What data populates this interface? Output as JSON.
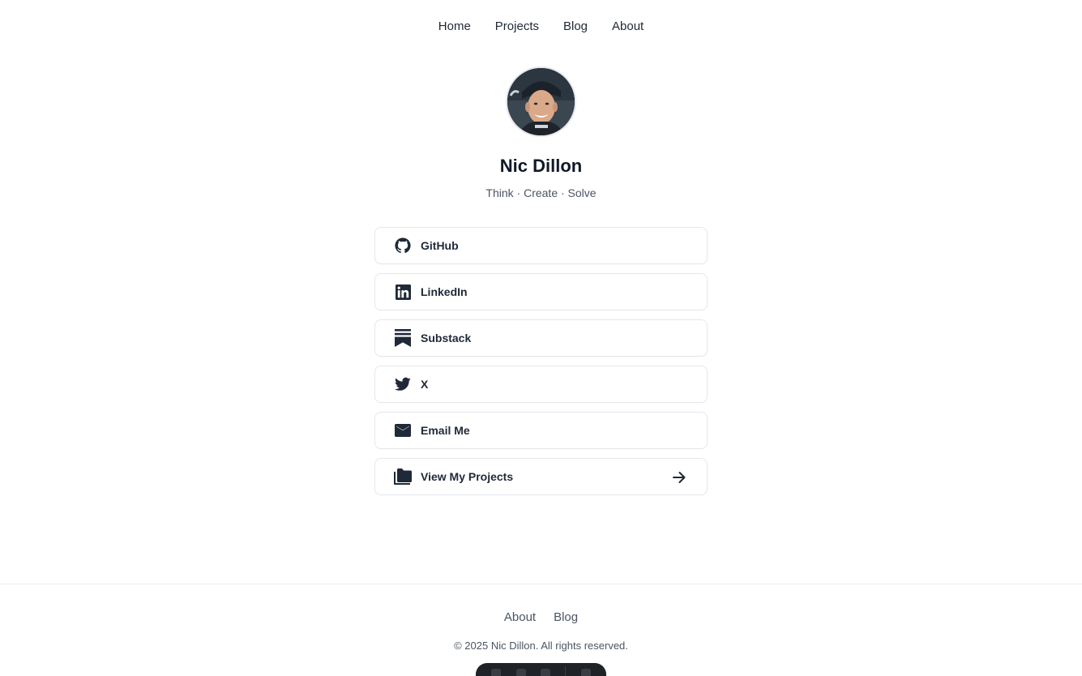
{
  "nav": {
    "items": [
      {
        "label": "Home"
      },
      {
        "label": "Projects"
      },
      {
        "label": "Blog"
      },
      {
        "label": "About"
      }
    ]
  },
  "profile": {
    "name": "Nic Dillon",
    "tagline": "Think · Create · Solve"
  },
  "links": [
    {
      "label": "GitHub",
      "icon": "github-icon"
    },
    {
      "label": "LinkedIn",
      "icon": "linkedin-icon"
    },
    {
      "label": "Substack",
      "icon": "substack-icon"
    },
    {
      "label": "X",
      "icon": "twitter-bird-icon"
    },
    {
      "label": "Email Me",
      "icon": "mail-icon"
    },
    {
      "label": "View My Projects",
      "icon": "folder-icon",
      "trailing_icon": "arrow-right-icon"
    }
  ],
  "footer": {
    "links": [
      {
        "label": "About"
      },
      {
        "label": "Blog"
      }
    ],
    "copyright": "© 2025 Nic Dillon. All rights reserved."
  },
  "colors": {
    "text_primary": "#111827",
    "text_secondary": "#4b5563",
    "border": "#e5e7eb",
    "dock_background": "#1f2226"
  }
}
